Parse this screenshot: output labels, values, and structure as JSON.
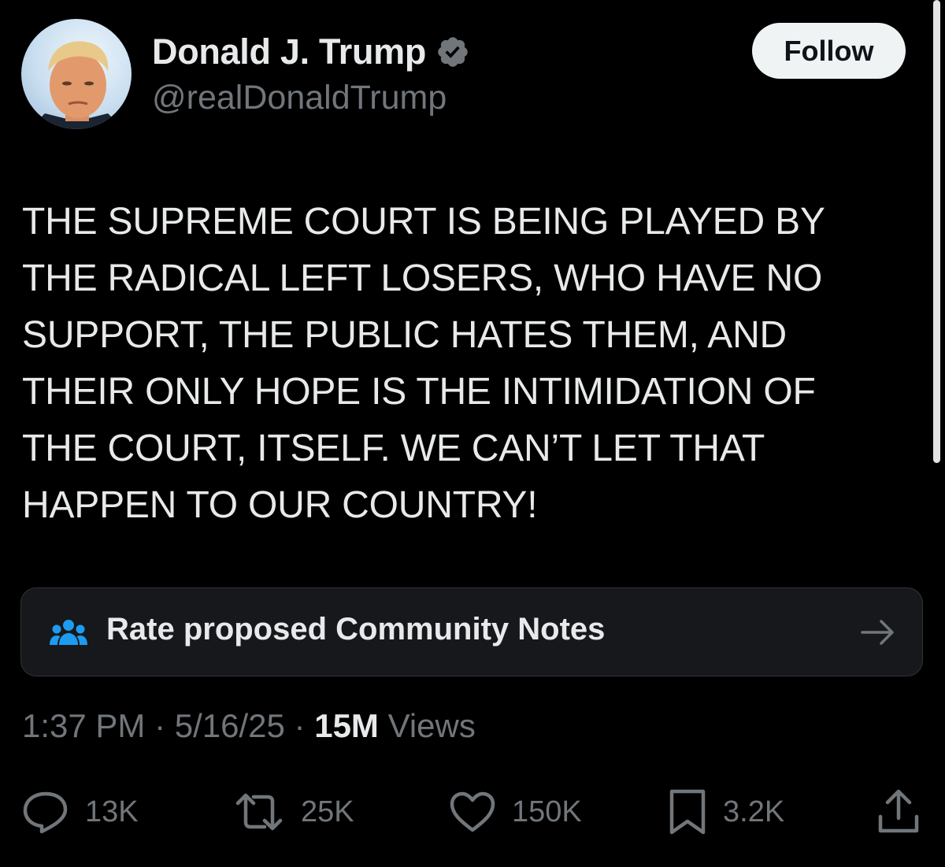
{
  "author": {
    "display_name": "Donald J. Trump",
    "handle": "@realDonaldTrump",
    "verified": true,
    "verified_color": "#71767b"
  },
  "follow_button": {
    "label": "Follow"
  },
  "tweet": {
    "text": "THE SUPREME COURT IS BEING PLAYED BY\nTHE RADICAL LEFT LOSERS, WHO HAVE NO\nSUPPORT, THE PUBLIC HATES THEM, AND\nTHEIR ONLY HOPE IS THE INTIMIDATION OF\nTHE COURT, ITSELF. WE CAN’T LET THAT\nHAPPEN TO OUR COUNTRY!"
  },
  "community_notes": {
    "label": "Rate proposed Community Notes",
    "icon": "people-icon",
    "icon_color": "#1d9bf0",
    "arrow_icon": "arrow-right-icon"
  },
  "meta": {
    "time": "1:37 PM",
    "separator": " · ",
    "date": "5/16/25",
    "views_count": "15M",
    "views_label": " Views"
  },
  "actions": {
    "replies": {
      "icon": "reply-icon",
      "count": "13K"
    },
    "reposts": {
      "icon": "repost-icon",
      "count": "25K"
    },
    "likes": {
      "icon": "heart-icon",
      "count": "150K"
    },
    "bookmarks": {
      "icon": "bookmark-icon",
      "count": "3.2K"
    },
    "share": {
      "icon": "share-icon"
    }
  },
  "colors": {
    "background": "#000000",
    "primary_text": "#e7e9ea",
    "secondary_text": "#71767b",
    "card_background": "#16181c",
    "follow_button_bg": "#eff3f4"
  }
}
